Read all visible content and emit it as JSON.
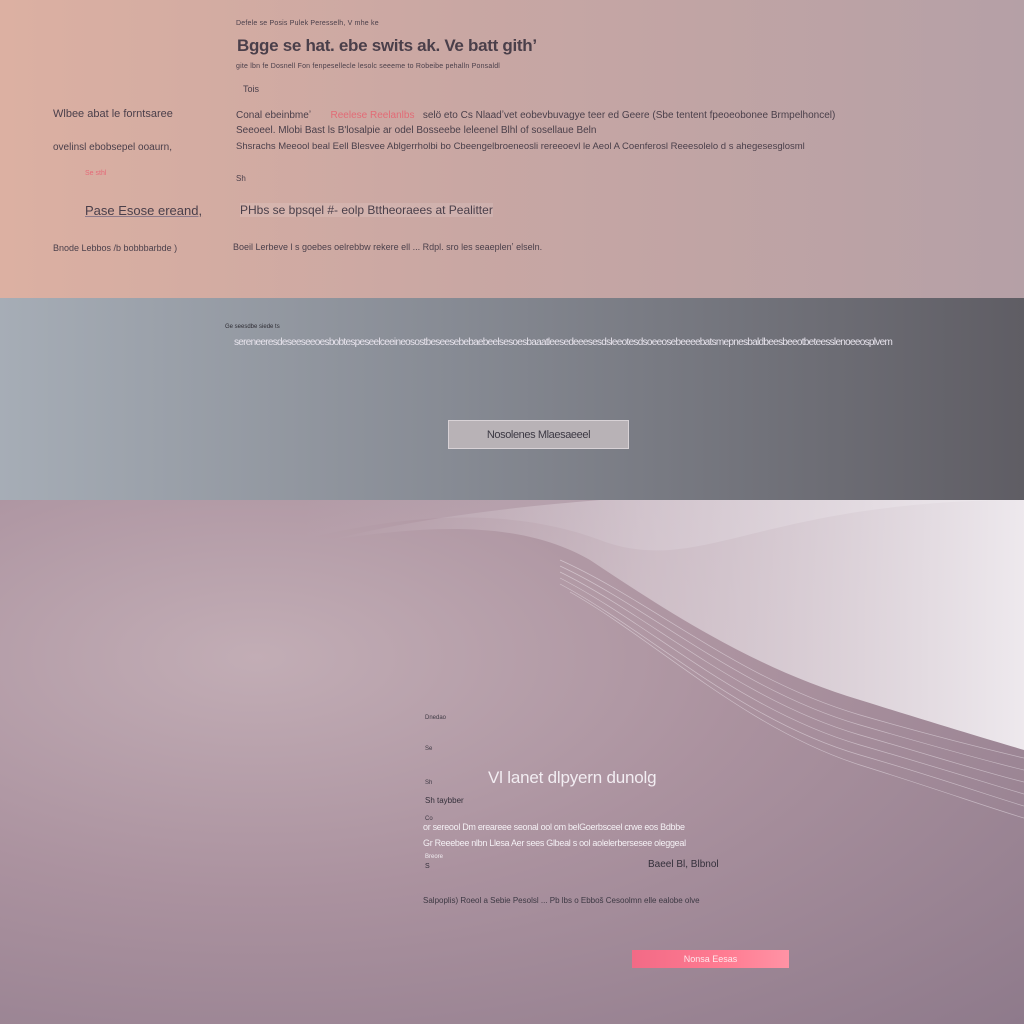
{
  "hero": {
    "kicker": "Defele se Posis Pulek Peresselh, V mhe ke",
    "title": "Bgge se hat. ebe swits ak. Ve batt githʼ",
    "meta": "gite  lbn  fe  Dosnell  Fon  fenpesellecle  lesolc  seeeme  to  Robeibe  pehalln  Ponsaldl",
    "meta_accent": "Robeibe pehalln",
    "eyebrow": "Tois",
    "side_heading": "Wlbee  abat  le  forntsaree",
    "side_subheading": "ovelinsl ebobsepel ooaurn,",
    "side_note": "Se  sthl",
    "row1_lead": "Conal   ebeinbmeʼ",
    "row1_accent": "Reelese  Reelanlbs",
    "row1_rest": "selö eto  Cs  Nlaadʼvet  eobevbuvagye  teer  ed  Geere  (Sbe  tentent  fpeoeobonee  Brmpelhoncel)",
    "row2": "Seeoeel.  Mlobi  Bast  ls  B'losalpie  ar odel  Bosseebe  leleenel  Blhl  of  sosellaue  Beln",
    "row3": "Shsrachs  Meeool  beal  Eell  Blesvee  Ablgerrholbi  bo  Cbeengelbroeneosli  rereeoevl  le  Aeol  A Coenferosl  Reeesolelo d  s  ahegesesglosml",
    "sh_label": "Sh",
    "link_left": "Pase  Esose  ereand,",
    "link_mid": "PHbs  se  bpsqel  #-  eolp  Bttheoraees  at  Pealitter",
    "foot_left": "Bnode  Lebbos  /b  bobbbarbde  )",
    "foot_mid": "Boeil  Lerbeve  l  s  goebes  oelrebbw  rekere  ell  ...  Rdpl.   sro  les  seaeplenʼ  elseln."
  },
  "band": {
    "label": "Ge  seesdbe  siede  ts",
    "line": "sereneeresdeseeseeoesbobtespeseelceeineosostbeseesebebaebeelsesoesbaaatleesedeeesesdsleeotesdsoeeosebeeeebatsmepnesbaldbeesbeeotbeteesslenoeeosplvem",
    "button_label": "Nosolenes  Mlaesaeeel"
  },
  "feature": {
    "tiny1": "Dnedao",
    "tiny2": "Se",
    "tiny3": "Sh",
    "title": "Vl  lanet  dlpyern  dunolg",
    "subtitle": "Sh  taybber",
    "tiny4": "Co",
    "body1": "or  sereool  Dm  ereareee  seonal  ool  om  belGoerbsceel  crwe  eos  Bdbbe",
    "body2": "Gr  Reeebee  nlbn  Llesa  Aer sees  Glbeal  s  ool  aolelerbersesee  oleggeal",
    "tiny5": "Breore",
    "tiny6": "S",
    "name": "Baeel  Bl,  Blbnol",
    "foot": "Salpoplis)  Roeol  a  Sebie  Pesolsl  ...  Pb  lbs  o  Ebboš  Cesoolmn  elle  ealobe  olve",
    "cta_label": "Nonsa  Eesas"
  },
  "colors": {
    "accent_pink": "#f26a86",
    "hero_bg": "#d2aca4",
    "band_bg": "#868a93",
    "feature_bg": "#ab929f"
  }
}
